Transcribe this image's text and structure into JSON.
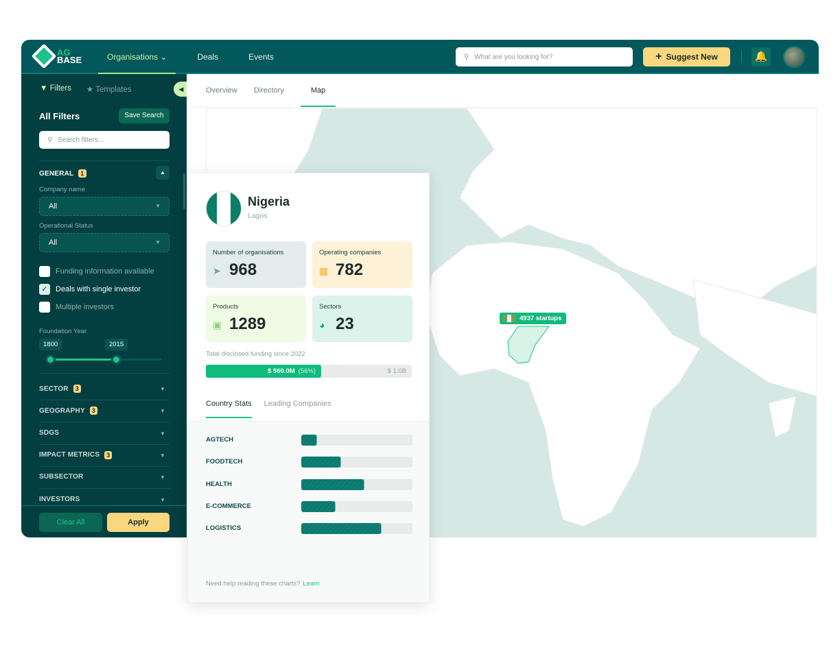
{
  "header": {
    "logo_top": "AG",
    "logo_bottom": "BASE",
    "nav": [
      "Organisations",
      "Deals",
      "Events"
    ],
    "search_placeholder": "What are you looking for?",
    "suggest_label": "Suggest New"
  },
  "sidebar": {
    "tabs": [
      "Filters",
      "Templates"
    ],
    "title": "All Filters",
    "save_search": "Save Search",
    "search_placeholder": "Search filters...",
    "general": {
      "label": "GENERAL",
      "badge": "1",
      "company_name_label": "Company name",
      "company_name_value": "All",
      "status_label": "Operational Status",
      "status_value": "All",
      "checkboxes": [
        {
          "label": "Funding information available",
          "checked": false
        },
        {
          "label": "Deals with single investor",
          "checked": true
        },
        {
          "label": "Multiple investors",
          "checked": false
        }
      ],
      "year_label": "Foundation Year",
      "year_min": "1800",
      "year_max": "2015"
    },
    "sections": [
      {
        "label": "SECTOR",
        "badge": "3"
      },
      {
        "label": "GEOGRAPHY",
        "badge": "3"
      },
      {
        "label": "SDGS"
      },
      {
        "label": "IMPACT METRICS",
        "badge": "3"
      },
      {
        "label": "SUBSECTOR"
      },
      {
        "label": "INVESTORS"
      }
    ],
    "clear_all": "Clear All",
    "apply": "Apply"
  },
  "main_tabs": [
    "Overview",
    "Directory",
    "Map"
  ],
  "map": {
    "tooltip": "4937 startups"
  },
  "panel": {
    "country": "Nigeria",
    "city": "Lagos",
    "stats": [
      {
        "label": "Number of organisations",
        "value": "968",
        "icon": "rocket-icon",
        "bg": "#e3ecea"
      },
      {
        "label": "Operating companies",
        "value": "782",
        "icon": "building-icon",
        "bg": "#fdf1d8"
      },
      {
        "label": "Products",
        "value": "1289",
        "icon": "box-icon",
        "bg": "#f0fbe6"
      },
      {
        "label": "Sectors",
        "value": "23",
        "icon": "pie-icon",
        "bg": "#dbf3ea"
      }
    ],
    "funding_label": "Total disclosed funding since 2022",
    "funding_value": "$ 560.0M",
    "funding_pct": "(56%)",
    "funding_progress": 56,
    "funding_max": "$ 1.0B",
    "tabs": [
      "Country Stats",
      "Leading Companies"
    ],
    "sectors": [
      {
        "name": "AGTECH",
        "pct": 14
      },
      {
        "name": "FOODTECH",
        "pct": 36
      },
      {
        "name": "HEALTH",
        "pct": 57
      },
      {
        "name": "E-COMMERCE",
        "pct": 31
      },
      {
        "name": "LOGISTICS",
        "pct": 72
      }
    ],
    "help_text": "Need help reading these charts?",
    "help_link": "Learn"
  },
  "colors": {
    "header": "#02585a",
    "sidebar": "#033f40",
    "accent": "#1ec28b",
    "yellow": "#fad77f"
  }
}
